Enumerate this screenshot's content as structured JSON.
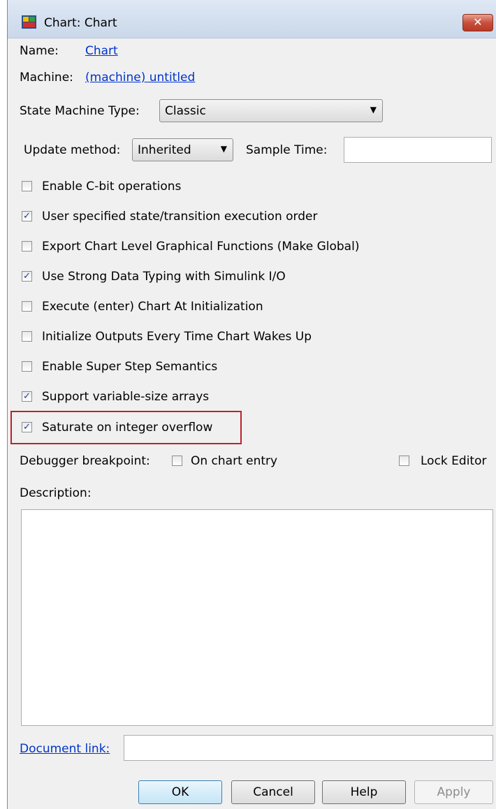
{
  "window": {
    "title": "Chart: Chart",
    "close_label": "✕"
  },
  "fields": {
    "name_label": "Name:",
    "name_value": "Chart",
    "machine_label": "Machine:",
    "machine_value": "(machine) untitled",
    "state_machine_type_label": "State Machine Type:",
    "state_machine_type_value": "Classic",
    "update_method_label": "Update method:",
    "update_method_value": "Inherited",
    "sample_time_label": "Sample Time:",
    "sample_time_value": ""
  },
  "options": [
    {
      "label": "Enable C-bit operations",
      "checked": false
    },
    {
      "label": "User specified state/transition execution order",
      "checked": true
    },
    {
      "label": "Export Chart Level Graphical Functions (Make Global)",
      "checked": false
    },
    {
      "label": "Use Strong Data Typing with Simulink I/O",
      "checked": true
    },
    {
      "label": "Execute (enter) Chart At Initialization",
      "checked": false
    },
    {
      "label": "Initialize Outputs Every Time Chart Wakes Up",
      "checked": false
    },
    {
      "label": "Enable Super Step Semantics",
      "checked": false
    },
    {
      "label": "Support variable-size arrays",
      "checked": true
    },
    {
      "label": "Saturate on integer overflow",
      "checked": true
    }
  ],
  "debugger": {
    "label": "Debugger breakpoint:",
    "on_chart_entry_label": "On chart entry",
    "on_chart_entry_checked": false,
    "lock_editor_label": "Lock Editor",
    "lock_editor_checked": false
  },
  "description": {
    "label": "Description:",
    "value": ""
  },
  "document_link": {
    "label": "Document link:",
    "value": ""
  },
  "buttons": {
    "ok": "OK",
    "cancel": "Cancel",
    "help": "Help",
    "apply": "Apply"
  },
  "colors": {
    "highlight": "#c0202a",
    "link": "#0033cc"
  }
}
